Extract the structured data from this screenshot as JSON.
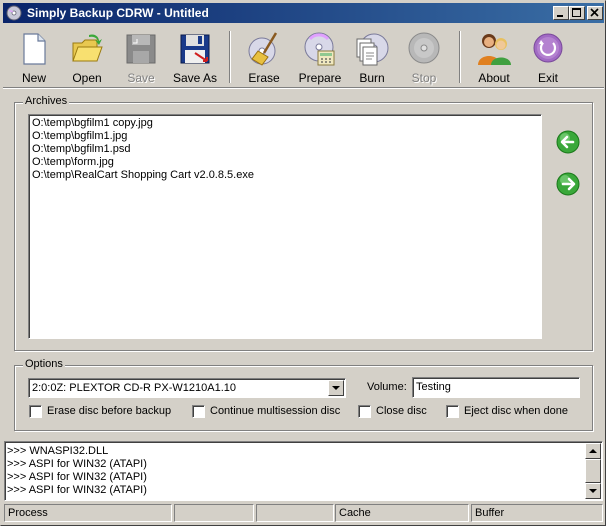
{
  "window": {
    "title": "Simply Backup CDRW - Untitled",
    "controls": {
      "minimize": "minimize",
      "maximize": "maximize",
      "close": "close"
    }
  },
  "toolbar": {
    "new": {
      "label": "New",
      "icon": "new-document-icon"
    },
    "open": {
      "label": "Open",
      "icon": "open-folder-icon"
    },
    "save": {
      "label": "Save",
      "icon": "save-disk-icon",
      "enabled": false
    },
    "save_as": {
      "label": "Save As",
      "icon": "save-as-icon"
    },
    "erase": {
      "label": "Erase",
      "icon": "erase-broom-icon"
    },
    "prepare": {
      "label": "Prepare",
      "icon": "prepare-disc-icon"
    },
    "burn": {
      "label": "Burn",
      "icon": "burn-disc-icon"
    },
    "stop": {
      "label": "Stop",
      "icon": "stop-disc-icon",
      "enabled": false
    },
    "about": {
      "label": "About",
      "icon": "about-people-icon"
    },
    "exit": {
      "label": "Exit",
      "icon": "exit-power-icon"
    }
  },
  "archives": {
    "legend": "Archives",
    "files": [
      "O:\\temp\\bgfilm1 copy.jpg",
      "O:\\temp\\bgfilm1.jpg",
      "O:\\temp\\bgfilm1.psd",
      "O:\\temp\\form.jpg",
      "O:\\temp\\RealCart Shopping Cart v2.0.8.5.exe"
    ],
    "add_button_icon": "arrow-left-icon",
    "remove_button_icon": "arrow-right-icon"
  },
  "options": {
    "legend": "Options",
    "drive": "2:0:0Z: PLEXTOR CD-R   PX-W1210A1.10",
    "volume_label": "Volume:",
    "volume_value": "Testing",
    "checkboxes": {
      "erase_before_backup": {
        "label": "Erase disc before backup",
        "checked": false
      },
      "continue_multisession": {
        "label": "Continue multisession disc",
        "checked": false
      },
      "close_disc": {
        "label": "Close disc",
        "checked": false
      },
      "eject_when_done": {
        "label": "Eject disc when done",
        "checked": false
      }
    }
  },
  "log": {
    "lines": [
      ">>> WNASPI32.DLL",
      ">>> ASPI for WIN32  (ATAPI)",
      ">>> ASPI for WIN32  (ATAPI)",
      ">>> ASPI for WIN32  (ATAPI)"
    ]
  },
  "statusbar": {
    "process": "Process",
    "panel2": "",
    "panel3": "",
    "cache": "Cache",
    "buffer": "Buffer"
  },
  "colors": {
    "titlebar_start": "#0a246a",
    "titlebar_end": "#3a6ea5",
    "face": "#d4d0c8",
    "arrow_green": "#3aa83a",
    "exit_purple": "#a16ac4"
  }
}
